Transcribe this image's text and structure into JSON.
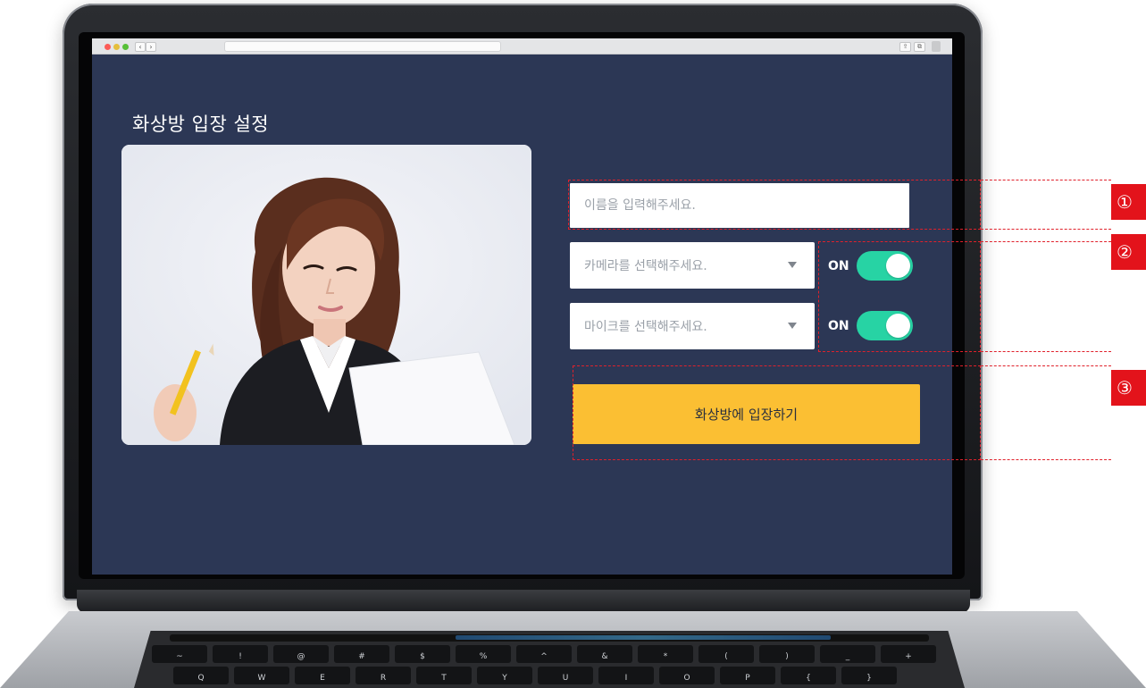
{
  "browser": {
    "nav_back": "‹",
    "nav_forward": "›",
    "share": "⇪",
    "tabs": "⧉"
  },
  "page": {
    "title": "화상방 입장 설정"
  },
  "form": {
    "name_placeholder": "이름을 입력해주세요.",
    "camera_select": "카메라를 선택해주세요.",
    "camera_toggle_label": "ON",
    "camera_on": true,
    "mic_select": "마이크를 선택해주세요.",
    "mic_toggle_label": "ON",
    "mic_on": true,
    "enter_button": "화상방에 입장하기"
  },
  "annotations": {
    "marker_1": "①",
    "marker_2": "②",
    "marker_3": "③"
  },
  "keyboard": {
    "row_top": [
      "~",
      "!",
      "@",
      "#",
      "$",
      "%",
      "^",
      "&",
      "*",
      "(",
      ")",
      "_",
      "+"
    ],
    "row_mid": [
      "Q",
      "W",
      "E",
      "R",
      "T",
      "Y",
      "U",
      "I",
      "O",
      "P",
      "{",
      "}"
    ]
  },
  "colors": {
    "screen_background": "#2c3755",
    "button_accent": "#fbbf33",
    "toggle_on": "#27d3a4",
    "annotation_red": "#e0212b"
  }
}
